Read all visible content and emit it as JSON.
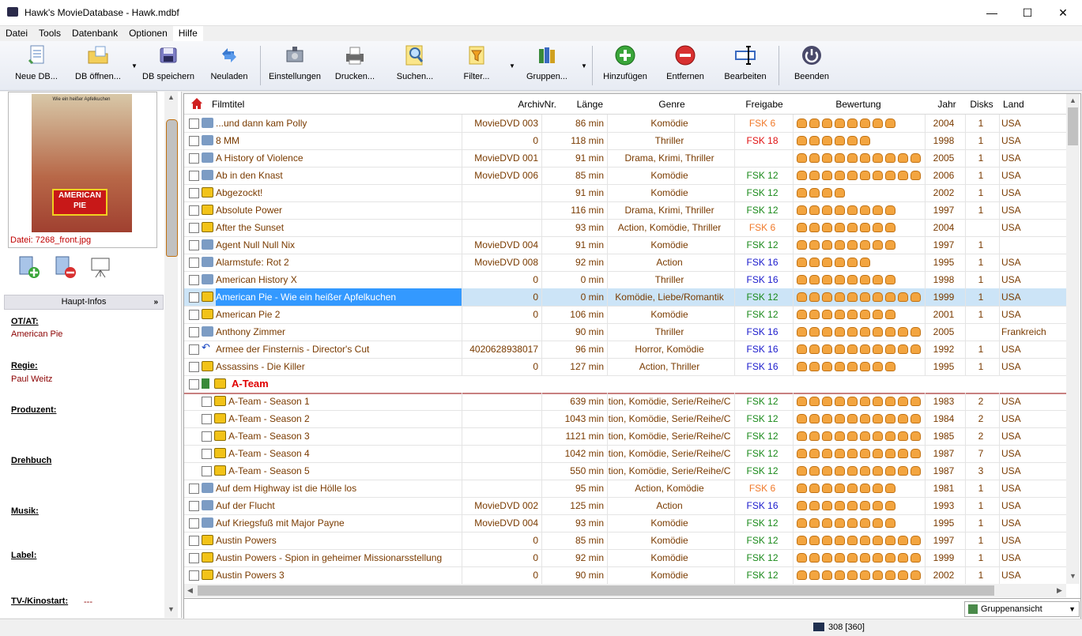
{
  "window": {
    "title": "Hawk's MovieDatabase - Hawk.mdbf"
  },
  "menu": [
    "Datei",
    "Tools",
    "Datenbank",
    "Optionen",
    "Hilfe"
  ],
  "toolbar": {
    "new": "Neue DB...",
    "open": "DB öffnen...",
    "save": "DB speichern",
    "reload": "Neuladen",
    "settings": "Einstellungen",
    "print": "Drucken...",
    "search": "Suchen...",
    "filter": "Filter...",
    "groups": "Gruppen...",
    "add": "Hinzufügen",
    "remove": "Entfernen",
    "edit": "Bearbeiten",
    "quit": "Beenden"
  },
  "left": {
    "poster_caption": "Datei: 7268_front.jpg",
    "poster_logo": "AMERICAN PIE",
    "poster_tagline": "Wie ein heißer Apfelkuchen",
    "section": "Haupt-Infos",
    "fields": {
      "otat_label": "OT/AT:",
      "otat_value": "American Pie",
      "regie_label": "Regie:",
      "regie_value": "Paul Weitz",
      "produzent_label": "Produzent:",
      "drehbuch_label": "Drehbuch",
      "musik_label": "Musik:",
      "label_label": "Label:",
      "kino_label": "TV-/Kinostart:",
      "kino_value": "---"
    }
  },
  "columns": {
    "title": "Filmtitel",
    "archive": "ArchivNr.",
    "length": "Länge",
    "genre": "Genre",
    "rating": "Freigabe",
    "score": "Bewertung",
    "year": "Jahr",
    "disks": "Disks",
    "country": "Land"
  },
  "rows": [
    {
      "t": "...und dann kam Polly",
      "a": "MovieDVD 003",
      "l": "86 min",
      "g": "Komödie",
      "f": "FSK 6",
      "s": 8,
      "y": "2004",
      "d": "1",
      "c": "USA",
      "i": "blue"
    },
    {
      "t": "8 MM",
      "a": "0",
      "l": "118 min",
      "g": "Thriller",
      "f": "FSK 18",
      "s": 6,
      "y": "1998",
      "d": "1",
      "c": "USA",
      "i": "blue"
    },
    {
      "t": "A History of Violence",
      "a": "MovieDVD 001",
      "l": "91 min",
      "g": "Drama, Krimi, Thriller",
      "f": "",
      "s": 10,
      "y": "2005",
      "d": "1",
      "c": "USA",
      "i": "blue"
    },
    {
      "t": "Ab in den Knast",
      "a": "MovieDVD 006",
      "l": "85 min",
      "g": "Komödie",
      "f": "FSK 12",
      "s": 10,
      "y": "2006",
      "d": "1",
      "c": "USA",
      "i": "blue"
    },
    {
      "t": "Abgezockt!",
      "a": "",
      "l": "91 min",
      "g": "Komödie",
      "f": "FSK 12",
      "s": 4,
      "y": "2002",
      "d": "1",
      "c": "USA",
      "i": "yellow"
    },
    {
      "t": "Absolute Power",
      "a": "",
      "l": "116 min",
      "g": "Drama, Krimi, Thriller",
      "f": "FSK 12",
      "s": 8,
      "y": "1997",
      "d": "1",
      "c": "USA",
      "i": "yellow"
    },
    {
      "t": "After the Sunset",
      "a": "",
      "l": "93 min",
      "g": "Action, Komödie, Thriller",
      "f": "FSK 6",
      "s": 8,
      "y": "2004",
      "d": "",
      "c": "USA",
      "i": "yellow"
    },
    {
      "t": "Agent Null Null Nix",
      "a": "MovieDVD 004",
      "l": "91 min",
      "g": "Komödie",
      "f": "FSK 12",
      "s": 8,
      "y": "1997",
      "d": "1",
      "c": "",
      "i": "blue"
    },
    {
      "t": "Alarmstufe: Rot 2",
      "a": "MovieDVD 008",
      "l": "92 min",
      "g": "Action",
      "f": "FSK 16",
      "s": 6,
      "y": "1995",
      "d": "1",
      "c": "USA",
      "i": "blue"
    },
    {
      "t": "American History X",
      "a": "0",
      "l": "0 min",
      "g": "Thriller",
      "f": "FSK 16",
      "s": 8,
      "y": "1998",
      "d": "1",
      "c": "USA",
      "i": "blue"
    },
    {
      "t": "American Pie - Wie ein heißer Apfelkuchen",
      "a": "0",
      "l": "0 min",
      "g": "Komödie, Liebe/Romantik",
      "f": "FSK 12",
      "s": 10,
      "y": "1999",
      "d": "1",
      "c": "USA",
      "i": "yellow",
      "sel": true
    },
    {
      "t": "American Pie 2",
      "a": "0",
      "l": "106 min",
      "g": "Komödie",
      "f": "FSK 12",
      "s": 8,
      "y": "2001",
      "d": "1",
      "c": "USA",
      "i": "yellow"
    },
    {
      "t": "Anthony Zimmer",
      "a": "",
      "l": "90 min",
      "g": "Thriller",
      "f": "FSK 16",
      "s": 10,
      "y": "2005",
      "d": "",
      "c": "Frankreich",
      "i": "blue"
    },
    {
      "t": "Armee der Finsternis - Director's Cut",
      "a": "4020628938017",
      "l": "96 min",
      "g": "Horror, Komödie",
      "f": "FSK 16",
      "s": 10,
      "y": "1992",
      "d": "1",
      "c": "USA",
      "i": "arrow"
    },
    {
      "t": "Assassins - Die Killer",
      "a": "0",
      "l": "127 min",
      "g": "Action, Thriller",
      "f": "FSK 16",
      "s": 8,
      "y": "1995",
      "d": "1",
      "c": "USA",
      "i": "yellow"
    },
    {
      "t": "A-Team",
      "group": true,
      "i": "yellow"
    },
    {
      "t": "A-Team - Season 1",
      "a": "",
      "l": "639 min",
      "g": "tion, Komödie, Serie/Reihe/C",
      "f": "FSK 12",
      "s": 10,
      "y": "1983",
      "d": "2",
      "c": "USA",
      "i": "yellow",
      "child": true
    },
    {
      "t": "A-Team - Season 2",
      "a": "",
      "l": "1043 min",
      "g": "tion, Komödie, Serie/Reihe/C",
      "f": "FSK 12",
      "s": 10,
      "y": "1984",
      "d": "2",
      "c": "USA",
      "i": "yellow",
      "child": true
    },
    {
      "t": "A-Team - Season 3",
      "a": "",
      "l": "1121 min",
      "g": "tion, Komödie, Serie/Reihe/C",
      "f": "FSK 12",
      "s": 10,
      "y": "1985",
      "d": "2",
      "c": "USA",
      "i": "yellow",
      "child": true
    },
    {
      "t": "A-Team - Season 4",
      "a": "",
      "l": "1042 min",
      "g": "tion, Komödie, Serie/Reihe/C",
      "f": "FSK 12",
      "s": 10,
      "y": "1987",
      "d": "7",
      "c": "USA",
      "i": "yellow",
      "child": true
    },
    {
      "t": "A-Team - Season 5",
      "a": "",
      "l": "550 min",
      "g": "tion, Komödie, Serie/Reihe/C",
      "f": "FSK 12",
      "s": 10,
      "y": "1987",
      "d": "3",
      "c": "USA",
      "i": "yellow",
      "child": true
    },
    {
      "t": "Auf dem Highway ist die Hölle los",
      "a": "",
      "l": "95 min",
      "g": "Action, Komödie",
      "f": "FSK 6",
      "s": 8,
      "y": "1981",
      "d": "1",
      "c": "USA",
      "i": "blue"
    },
    {
      "t": "Auf der Flucht",
      "a": "MovieDVD 002",
      "l": "125 min",
      "g": "Action",
      "f": "FSK 16",
      "s": 8,
      "y": "1993",
      "d": "1",
      "c": "USA",
      "i": "blue"
    },
    {
      "t": "Auf Kriegsfuß mit Major Payne",
      "a": "MovieDVD 004",
      "l": "93 min",
      "g": "Komödie",
      "f": "FSK 12",
      "s": 8,
      "y": "1995",
      "d": "1",
      "c": "USA",
      "i": "blue"
    },
    {
      "t": "Austin Powers",
      "a": "0",
      "l": "85 min",
      "g": "Komödie",
      "f": "FSK 12",
      "s": 10,
      "y": "1997",
      "d": "1",
      "c": "USA",
      "i": "yellow"
    },
    {
      "t": "Austin Powers - Spion in geheimer Missionarsstellung",
      "a": "0",
      "l": "92 min",
      "g": "Komödie",
      "f": "FSK 12",
      "s": 10,
      "y": "1999",
      "d": "1",
      "c": "USA",
      "i": "yellow"
    },
    {
      "t": "Austin Powers 3",
      "a": "0",
      "l": "90 min",
      "g": "Komödie",
      "f": "FSK 12",
      "s": 10,
      "y": "2002",
      "d": "1",
      "c": "USA",
      "i": "yellow"
    }
  ],
  "rating_colors": {
    "FSK 6": "#f07828",
    "FSK 12": "#1a8a1a",
    "FSK 16": "#1a1acc",
    "FSK 18": "#e01010"
  },
  "view_select": "Gruppenansicht",
  "status_count": "308 [360]"
}
